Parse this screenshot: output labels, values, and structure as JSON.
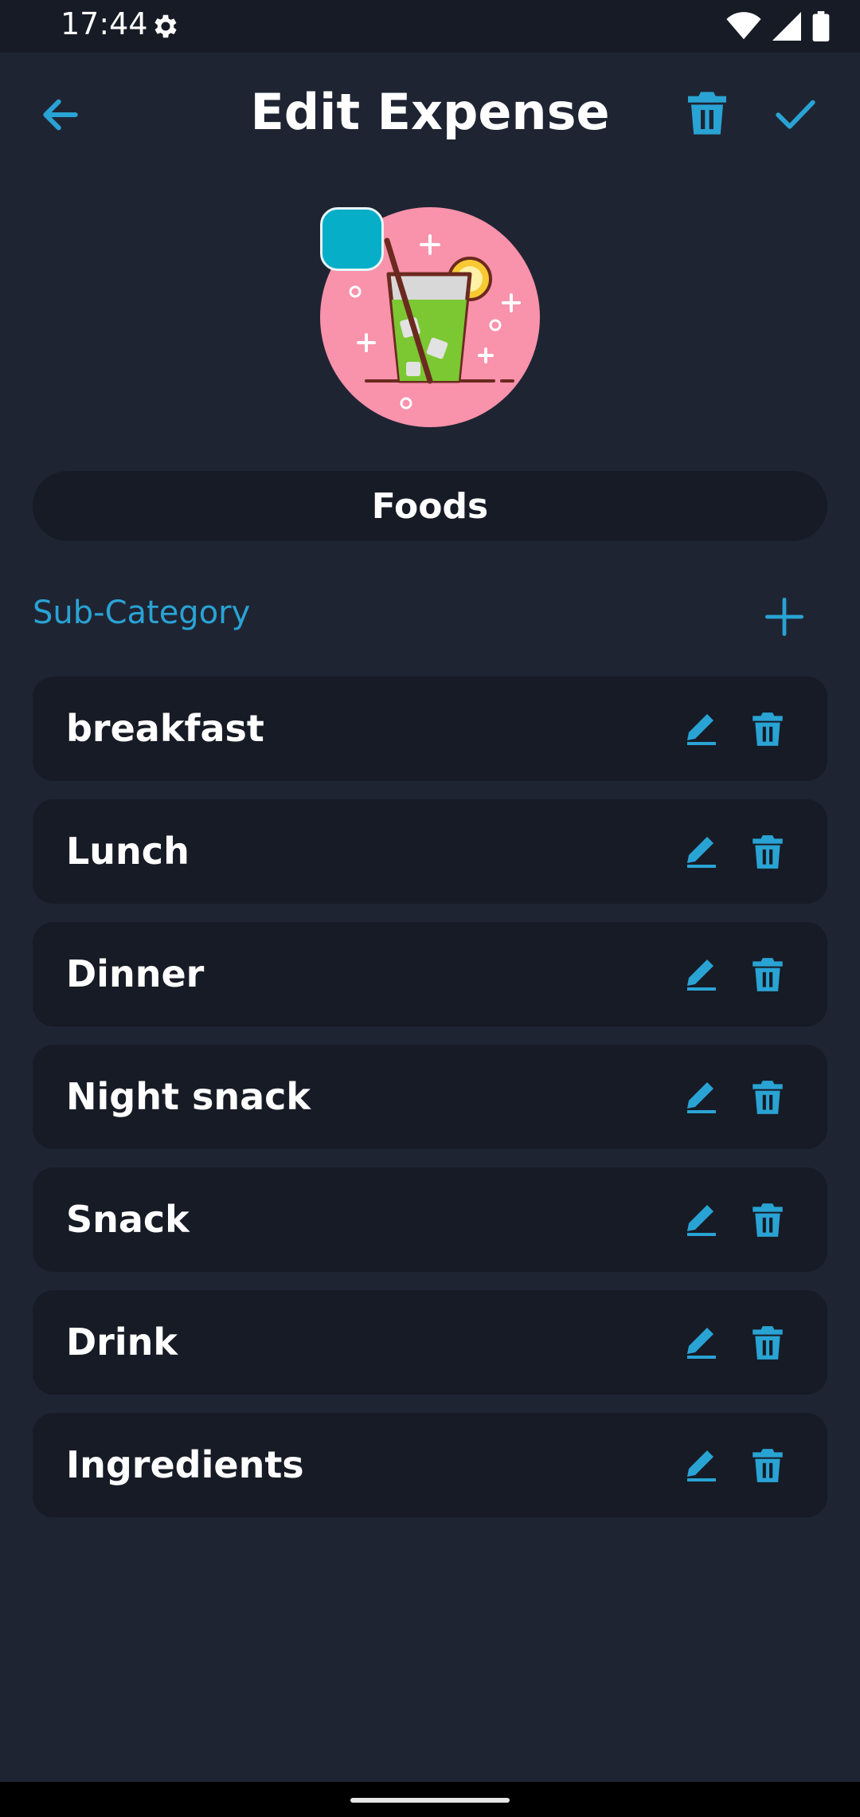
{
  "status_bar": {
    "time": "17:44"
  },
  "app_bar": {
    "title": "Edit Expense"
  },
  "category": {
    "name": "Foods",
    "swatch_color": "#06aec8",
    "icon": "cocktail-glass-icon"
  },
  "subcategory": {
    "header": "Sub-Category",
    "items": [
      "breakfast",
      "Lunch",
      "Dinner",
      "Night snack",
      "Snack",
      "Drink",
      "Ingredients"
    ]
  },
  "colors": {
    "accent": "#29a3d4",
    "background": "#1f2433",
    "card": "#171b25"
  }
}
